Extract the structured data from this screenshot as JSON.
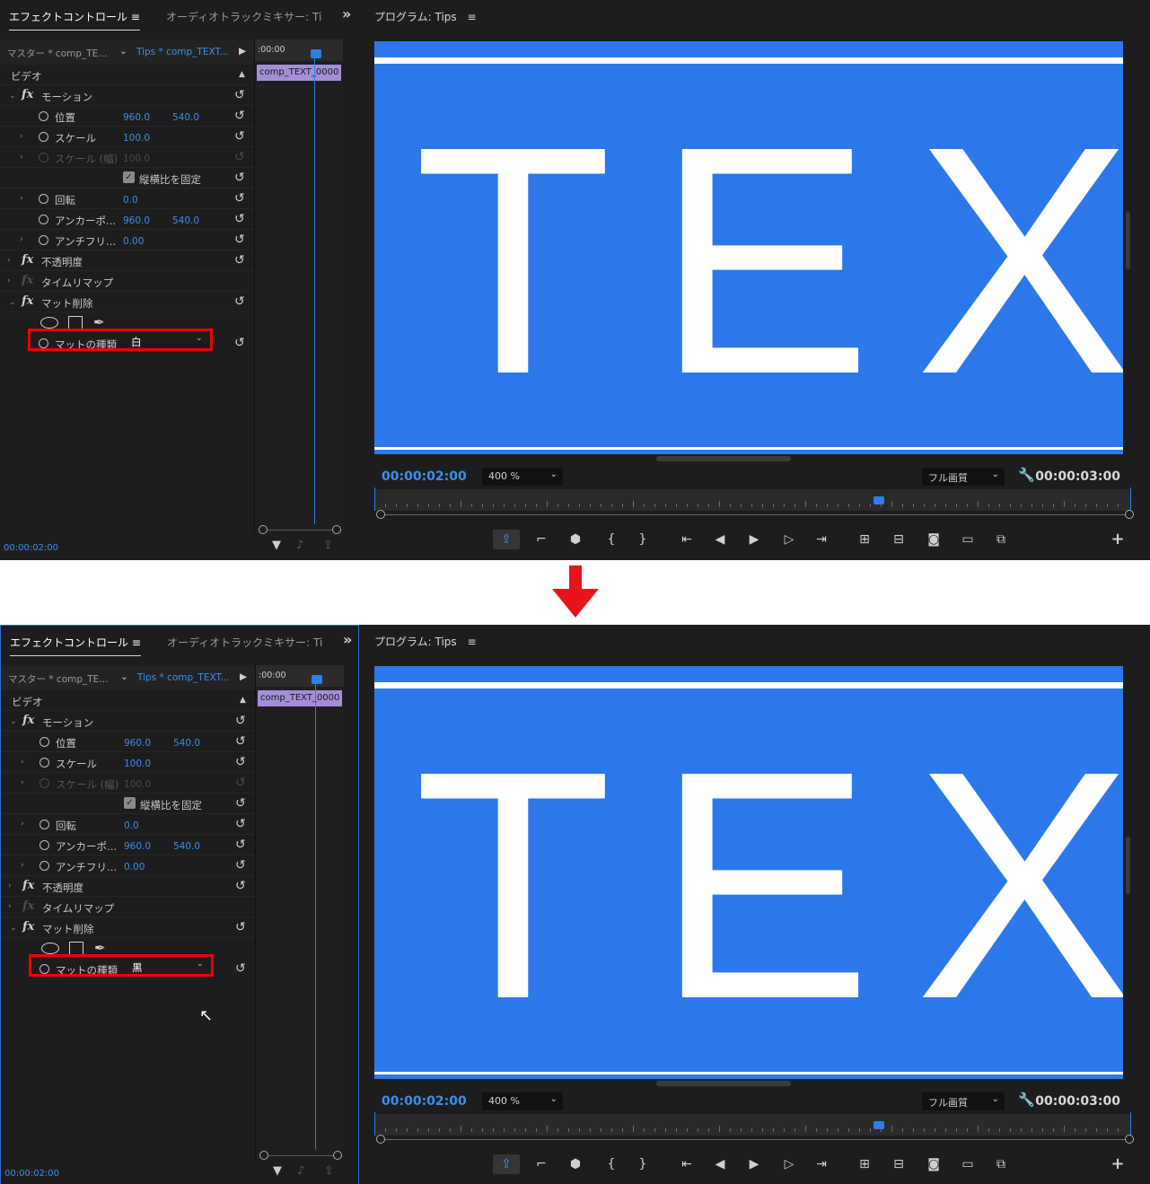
{
  "arrow_color": "#e8141b",
  "screens": [
    {
      "tabs": {
        "effect_controls": "エフェクトコントロール",
        "audio_mixer": "オーディオトラックミキサー: Ti",
        "menu_icon": "≡",
        "more": "»"
      },
      "breadcrumb": {
        "master": "マスター * comp_TE...",
        "clip": "Tips * comp_TEXT..."
      },
      "section": "ビデオ",
      "rows": {
        "motion": "モーション",
        "position": {
          "label": "位置",
          "x": "960.0",
          "y": "540.0"
        },
        "scale": {
          "label": "スケール",
          "value": "100.0"
        },
        "scale_width": {
          "label": "スケール (幅)",
          "value": "100.0"
        },
        "uniform_scale": "縦横比を固定",
        "rotation": {
          "label": "回転",
          "value": "0.0"
        },
        "anchor": {
          "label": "アンカーポ...",
          "x": "960.0",
          "y": "540.0"
        },
        "antiflicker": {
          "label": "アンチフリ...",
          "value": "0.00"
        },
        "opacity": "不透明度",
        "time_remap": "タイムリマップ",
        "matte_remove": "マット削除",
        "matte_type": {
          "label": "マットの種類",
          "value": "白"
        }
      },
      "timeline": {
        "ruler": ":00:00",
        "clip": "comp_TEXT_0000"
      },
      "panel_timecode": "00:00:02:00",
      "program": {
        "title": "プログラム: Tips",
        "video_text": "TEX",
        "current_time": "00:00:02:00",
        "zoom": "400 %",
        "quality": "フル画質",
        "duration": "00:00:03:00"
      }
    },
    {
      "tabs": {
        "effect_controls": "エフェクトコントロール",
        "audio_mixer": "オーディオトラックミキサー: Ti",
        "menu_icon": "≡",
        "more": "»"
      },
      "breadcrumb": {
        "master": "マスター * comp_TE...",
        "clip": "Tips * comp_TEXT..."
      },
      "section": "ビデオ",
      "rows": {
        "motion": "モーション",
        "position": {
          "label": "位置",
          "x": "960.0",
          "y": "540.0"
        },
        "scale": {
          "label": "スケール",
          "value": "100.0"
        },
        "scale_width": {
          "label": "スケール (幅)",
          "value": "100.0"
        },
        "uniform_scale": "縦横比を固定",
        "rotation": {
          "label": "回転",
          "value": "0.0"
        },
        "anchor": {
          "label": "アンカーポ...",
          "x": "960.0",
          "y": "540.0"
        },
        "antiflicker": {
          "label": "アンチフリ...",
          "value": "0.00"
        },
        "opacity": "不透明度",
        "time_remap": "タイムリマップ",
        "matte_remove": "マット削除",
        "matte_type": {
          "label": "マットの種類",
          "value": "黒"
        }
      },
      "timeline": {
        "ruler": ":00:00",
        "clip": "comp_TEXT_0000"
      },
      "panel_timecode": "00:00:02:00",
      "program": {
        "title": "プログラム: Tips",
        "video_text": "TEX",
        "current_time": "00:00:02:00",
        "zoom": "400 %",
        "quality": "フル画質",
        "duration": "00:00:03:00"
      }
    }
  ]
}
